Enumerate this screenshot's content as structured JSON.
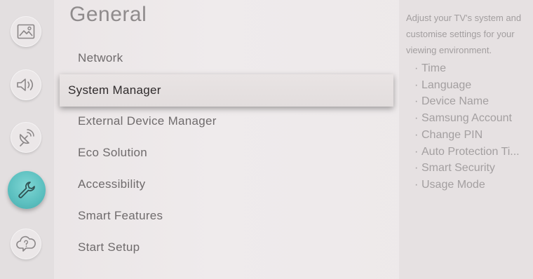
{
  "rail": {
    "items": [
      {
        "name": "picture-icon",
        "active": false
      },
      {
        "name": "sound-icon",
        "active": false
      },
      {
        "name": "broadcasting-icon",
        "active": false
      },
      {
        "name": "wrench-icon",
        "active": true
      },
      {
        "name": "support-icon",
        "active": false
      }
    ],
    "accent_color": "#5bbfbf"
  },
  "menu": {
    "title": "General",
    "items": [
      {
        "label": "Network"
      },
      {
        "label": "System Manager",
        "selected": true
      },
      {
        "label": "External Device Manager"
      },
      {
        "label": "Eco Solution"
      },
      {
        "label": "Accessibility"
      },
      {
        "label": "Smart Features"
      },
      {
        "label": "Start Setup"
      }
    ]
  },
  "panel": {
    "description": "Adjust your TV's system and customise settings for your viewing environment.",
    "bullet": "·",
    "items": [
      "Time",
      "Language",
      "Device Name",
      "Samsung Account",
      "Change PIN",
      "Auto Protection Ti...",
      "Smart Security",
      "Usage Mode"
    ]
  }
}
